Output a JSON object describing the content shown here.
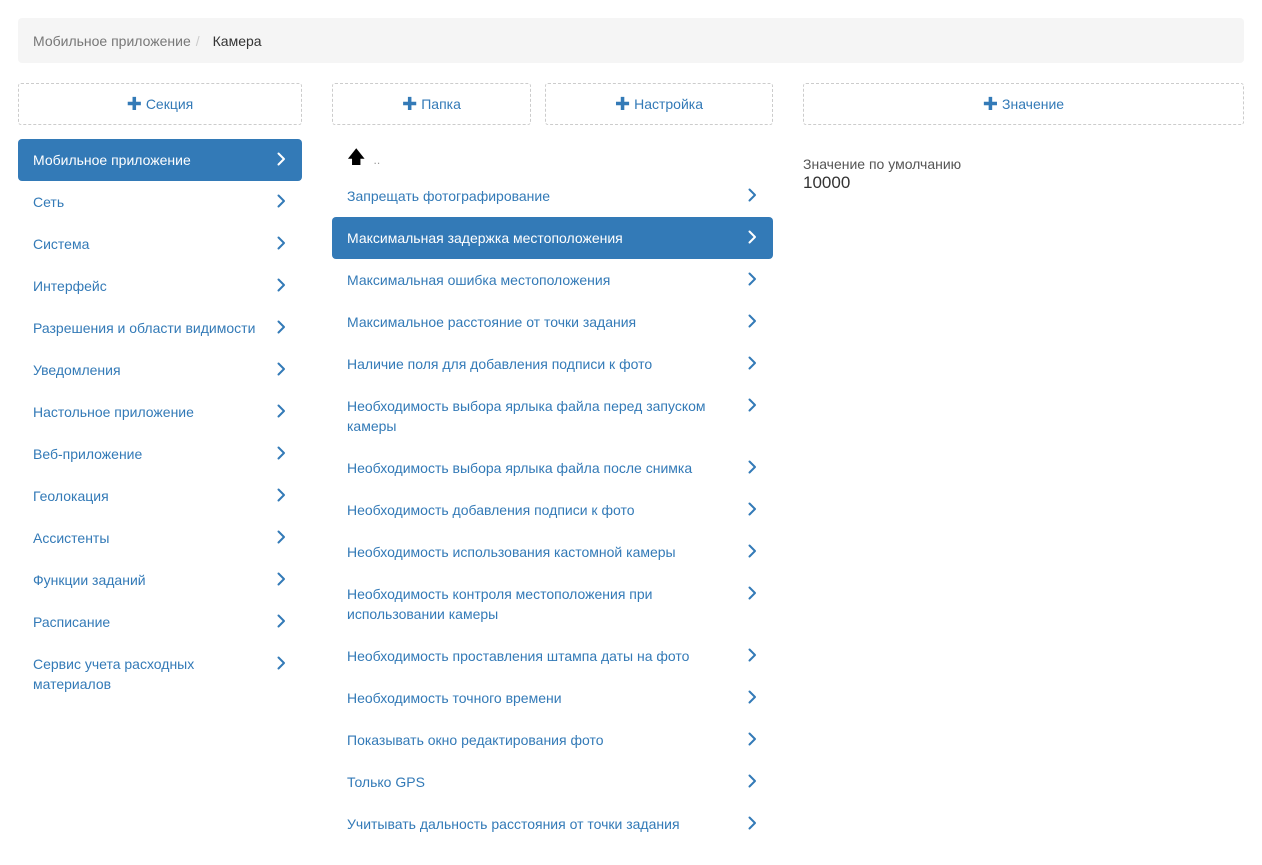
{
  "breadcrumb": {
    "parent": "Мобильное приложение",
    "separator": "/",
    "current": "Камера"
  },
  "buttons": {
    "add_section": "Секция",
    "add_folder": "Папка",
    "add_setting": "Настройка",
    "add_value": "Значение"
  },
  "sections": [
    {
      "label": "Мобильное приложение",
      "active": true
    },
    {
      "label": "Сеть"
    },
    {
      "label": "Система"
    },
    {
      "label": "Интерфейс"
    },
    {
      "label": "Разрешения и области видимости"
    },
    {
      "label": "Уведомления"
    },
    {
      "label": "Настольное приложение"
    },
    {
      "label": "Веб-приложение"
    },
    {
      "label": "Геолокация"
    },
    {
      "label": "Ассистенты"
    },
    {
      "label": "Функции заданий"
    },
    {
      "label": "Расписание"
    },
    {
      "label": "Сервис учета расходных материалов"
    }
  ],
  "settings_up": "..",
  "settings": [
    {
      "label": "Запрещать фотографирование"
    },
    {
      "label": "Максимальная задержка местоположения",
      "active": true
    },
    {
      "label": "Максимальная ошибка местоположения"
    },
    {
      "label": "Максимальное расстояние от точки задания"
    },
    {
      "label": "Наличие поля для добавления подписи к фото"
    },
    {
      "label": "Необходимость выбора ярлыка файла перед запуском камеры"
    },
    {
      "label": "Необходимость выбора ярлыка файла после снимка"
    },
    {
      "label": "Необходимость добавления подписи к фото"
    },
    {
      "label": "Необходимость использования кастомной камеры"
    },
    {
      "label": "Необходимость контроля местоположения при использовании камеры"
    },
    {
      "label": "Необходимость проставления штампа даты на фото"
    },
    {
      "label": "Необходимость точного времени"
    },
    {
      "label": "Показывать окно редактирования фото"
    },
    {
      "label": "Только GPS"
    },
    {
      "label": "Учитывать дальность расстояния от точки задания"
    }
  ],
  "value": {
    "label": "Значение по умолчанию",
    "value": "10000"
  },
  "icons": {
    "plus": "plus-icon",
    "chevron": "chevron-right-icon",
    "up": "arrow-up-icon"
  },
  "colors": {
    "accent": "#337ab7",
    "breadcrumb_bg": "#f5f5f5"
  }
}
